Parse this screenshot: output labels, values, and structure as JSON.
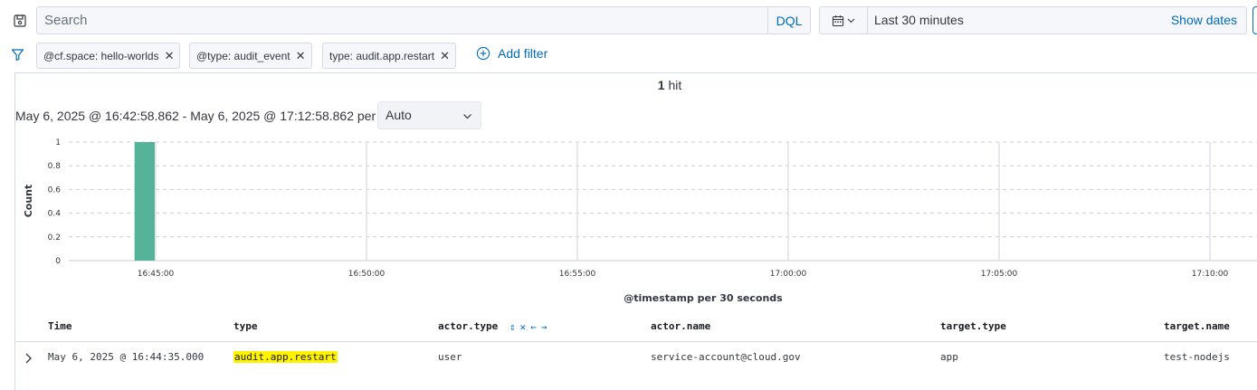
{
  "topbar": {
    "search_placeholder": "Search",
    "query_language": "DQL",
    "time_range": "Last 30 minutes",
    "show_dates": "Show dates"
  },
  "filters": {
    "pills": [
      {
        "label": "@cf.space: hello-worlds"
      },
      {
        "label": "@type: audit_event"
      },
      {
        "label": "type: audit.app.restart"
      }
    ],
    "add_filter": "Add filter"
  },
  "results": {
    "hit_count": "1",
    "hit_label": "hit",
    "range_text": "May 6, 2025 @ 16:42:58.862 - May 6, 2025 @ 17:12:58.862 per",
    "interval": "Auto"
  },
  "chart_data": {
    "type": "bar",
    "ylabel": "Count",
    "xlabel": "@timestamp per 30 seconds",
    "yticks": [
      "0",
      "0.2",
      "0.4",
      "0.6",
      "0.8",
      "1"
    ],
    "ylim": [
      0,
      1
    ],
    "xticks": [
      "16:45:00",
      "16:50:00",
      "16:55:00",
      "17:00:00",
      "17:05:00",
      "17:10:00"
    ],
    "bars": [
      {
        "x": "16:44:30",
        "value": 1
      }
    ],
    "bar_color": "#54b399",
    "grid": true
  },
  "table": {
    "columns": [
      "Time",
      "type",
      "actor.type",
      "actor.name",
      "target.type",
      "target.name"
    ],
    "rows": [
      {
        "time": "May 6, 2025 @ 16:44:35.000",
        "type": "audit.app.restart",
        "actor_type": "user",
        "actor_name": "service-account@cloud.gov",
        "target_type": "app",
        "target_name": "test-nodejs"
      }
    ]
  },
  "colors": {
    "accent": "#006bb8",
    "highlight": "#fff200",
    "bar": "#54b399"
  }
}
